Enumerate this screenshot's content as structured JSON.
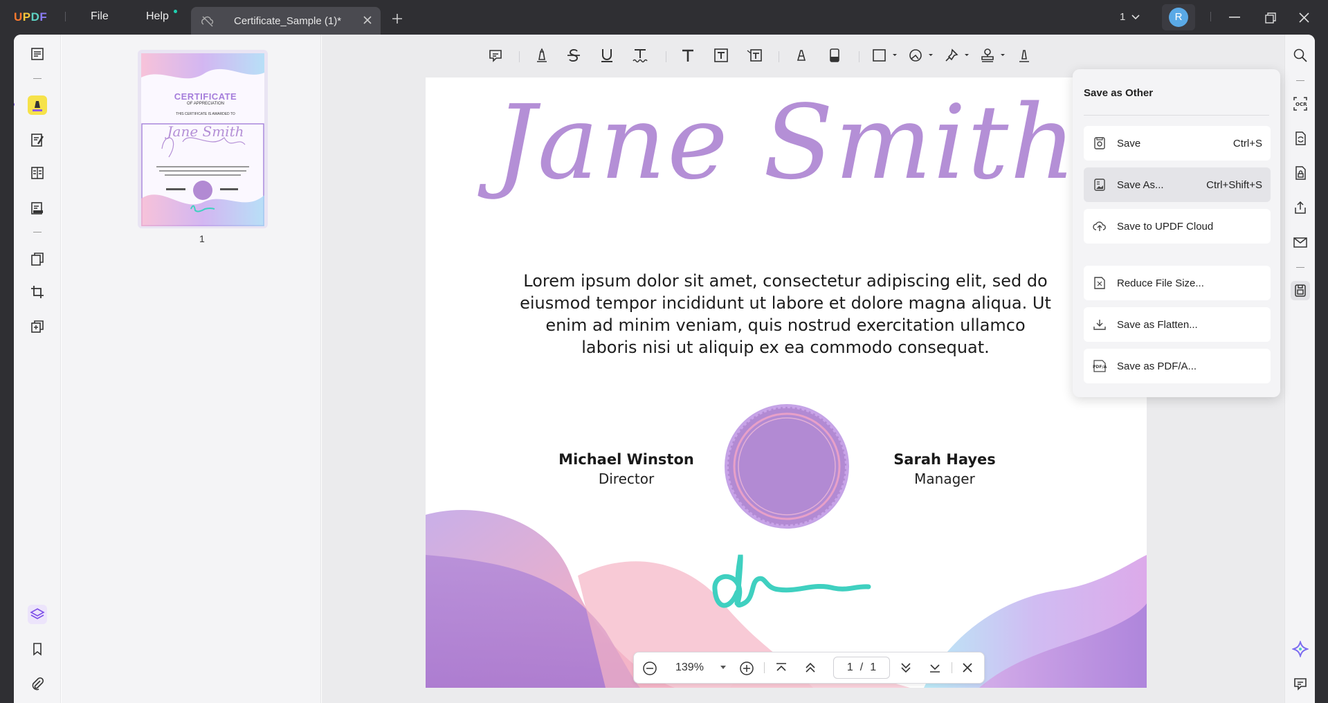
{
  "titlebar": {
    "logo_text": "UPDF",
    "menu": [
      {
        "label": "File"
      },
      {
        "label": "Help"
      }
    ],
    "tab_title": "Certificate_Sample (1)*",
    "page_selector": "1",
    "avatar_letter": "R"
  },
  "thumbnail": {
    "page_number": "1",
    "cert_title": "CERTIFICATE",
    "cert_sub": "OF APPRECIATION",
    "cert_awarded": "THIS CERTIFICATE IS AWARDED TO",
    "cert_name": "Jane Smith"
  },
  "document": {
    "name_signature": "Jane Smith",
    "body": "Lorem ipsum dolor sit amet, consectetur adipiscing elit, sed do eiusmod tempor incididunt ut labore et dolore magna aliqua. Ut enim ad minim veniam, quis nostrud exercitation ullamco laboris nisi ut aliquip ex ea commodo consequat.",
    "signer_left": {
      "name": "Michael Winston",
      "role": "Director"
    },
    "signer_right": {
      "name": "Sarah Hayes",
      "role": "Manager"
    }
  },
  "zoombar": {
    "zoom": "139%",
    "current_page": "1",
    "separator": "/",
    "total_pages": "1"
  },
  "save_panel": {
    "title": "Save as Other",
    "items": [
      {
        "label": "Save",
        "shortcut": "Ctrl+S"
      },
      {
        "label": "Save As...",
        "shortcut": "Ctrl+Shift+S"
      },
      {
        "label": "Save to UPDF Cloud",
        "shortcut": ""
      },
      {
        "label": "Reduce File Size...",
        "shortcut": ""
      },
      {
        "label": "Save as Flatten...",
        "shortcut": ""
      },
      {
        "label": "Save as PDF/A...",
        "shortcut": ""
      }
    ]
  },
  "colors": {
    "accent_yellow": "#f6e24a",
    "signature_purple": "#b48fd6",
    "seal_purple": "#b28ad3",
    "ink_teal": "#3fd0c0",
    "titlebar_bg": "#2f2f33"
  }
}
